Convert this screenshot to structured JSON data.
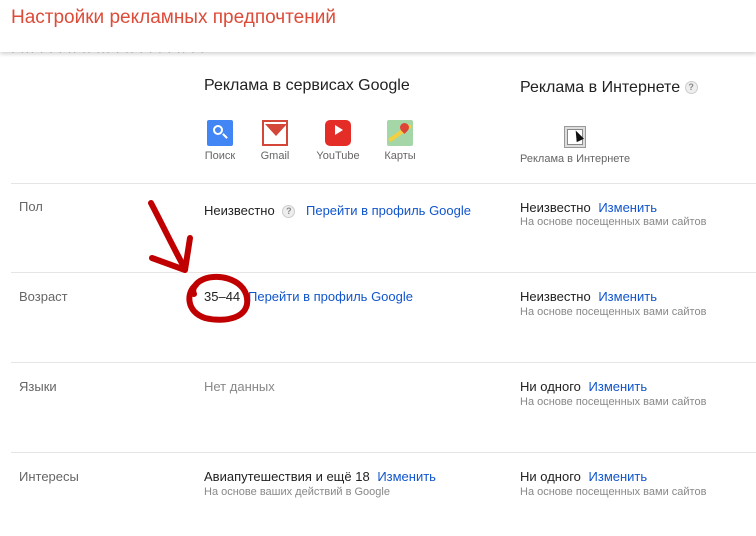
{
  "header": {
    "title": "Настройки рекламных предпочтений",
    "cutoff": "· ··· · · · ·· ·· ··· ·  ·· · · · · ·· · ·"
  },
  "columns": {
    "google_title": "Реклама в сервисах Google",
    "web_title": "Реклама в Интернете",
    "help_glyph": "?"
  },
  "services": [
    {
      "name": "Поиск",
      "icon": "search-icon"
    },
    {
      "name": "Gmail",
      "icon": "gmail-icon"
    },
    {
      "name": "YouTube",
      "icon": "youtube-icon"
    },
    {
      "name": "Карты",
      "icon": "maps-icon"
    }
  ],
  "web_service": {
    "label": "Реклама в Интернете",
    "icon": "web-cursor-icon"
  },
  "rows": [
    {
      "label": "Пол",
      "google_value": "Неизвестно",
      "google_link": "Перейти в профиль Google",
      "web_value": "Неизвестно",
      "web_link": "Изменить",
      "web_sub": "На основе посещенных вами сайтов"
    },
    {
      "label": "Возраст",
      "google_value": "35–44",
      "google_link": "Перейти в профиль Google",
      "web_value": "Неизвестно",
      "web_link": "Изменить",
      "web_sub": "На основе посещенных вами сайтов"
    },
    {
      "label": "Языки",
      "google_value": "Нет данных",
      "web_value": "Ни одного",
      "web_link": "Изменить",
      "web_sub": "На основе посещенных вами сайтов"
    },
    {
      "label": "Интересы",
      "google_value": "Авиапутешествия и ещё 18",
      "google_link": "Изменить",
      "google_sub": "На основе ваших действий в Google",
      "web_value": "Ни одного",
      "web_link": "Изменить",
      "web_sub": "На основе посещенных вами сайтов"
    }
  ],
  "colors": {
    "title": "#dd4b39",
    "link": "#1155cc",
    "annotation": "#c00000"
  }
}
